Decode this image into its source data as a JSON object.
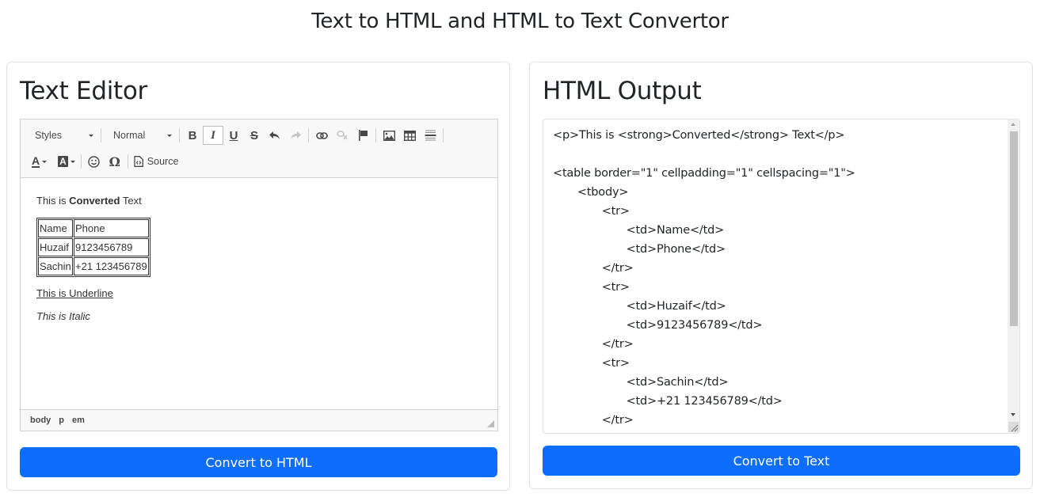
{
  "page": {
    "title": "Text to HTML and HTML to Text Convertor",
    "accent_color": "#0d6efd"
  },
  "editor_panel": {
    "heading": "Text Editor",
    "toolbar": {
      "styles_combo": "Styles",
      "format_combo": "Normal",
      "buttons": [
        {
          "name": "bold",
          "label": "B",
          "state": "normal"
        },
        {
          "name": "italic",
          "label": "I",
          "state": "active"
        },
        {
          "name": "underline",
          "label": "U",
          "state": "normal"
        },
        {
          "name": "strikethrough",
          "label": "S",
          "state": "normal"
        },
        {
          "name": "undo",
          "icon": "undo-icon",
          "state": "normal"
        },
        {
          "name": "redo",
          "icon": "redo-icon",
          "state": "disabled"
        },
        {
          "name": "link",
          "icon": "link-icon",
          "state": "normal"
        },
        {
          "name": "unlink",
          "icon": "unlink-icon",
          "state": "disabled"
        },
        {
          "name": "anchor",
          "icon": "flag-icon",
          "state": "normal"
        },
        {
          "name": "image",
          "icon": "image-icon",
          "state": "normal"
        },
        {
          "name": "table",
          "icon": "table-icon",
          "state": "normal"
        },
        {
          "name": "horizontal-line",
          "icon": "horizontal-line-icon",
          "state": "normal"
        },
        {
          "name": "text-color",
          "label": "A",
          "icon": "text-color-icon"
        },
        {
          "name": "background-color",
          "label": "A",
          "icon": "background-color-icon"
        },
        {
          "name": "smiley",
          "icon": "smiley-icon"
        },
        {
          "name": "special-char",
          "label": "Ω",
          "icon": "omega-icon"
        }
      ],
      "source_label": "Source"
    },
    "content": {
      "para1_before": "This is ",
      "para1_bold": "Converted",
      "para1_after": " Text",
      "table": [
        [
          "Name",
          "Phone"
        ],
        [
          "Huzaif",
          "9123456789"
        ],
        [
          "Sachin",
          "+21 123456789"
        ]
      ],
      "underline_text": "This is Underline",
      "italic_text": "This is Italic"
    },
    "element_path": [
      "body",
      "p",
      "em"
    ],
    "convert_button": "Convert to HTML"
  },
  "output_panel": {
    "heading": "HTML Output",
    "output_value": "<p>This is <strong>Converted</strong> Text</p>\n\n<table border=\"1\" cellpadding=\"1\" cellspacing=\"1\">\n\t<tbody>\n\t\t<tr>\n\t\t\t<td>Name</td>\n\t\t\t<td>Phone</td>\n\t\t</tr>\n\t\t<tr>\n\t\t\t<td>Huzaif</td>\n\t\t\t<td>9123456789</td>\n\t\t</tr>\n\t\t<tr>\n\t\t\t<td>Sachin</td>\n\t\t\t<td>+21 123456789</td>\n\t\t</tr>\n\t</tbody>\n</table>",
    "convert_button": "Convert to Text"
  }
}
